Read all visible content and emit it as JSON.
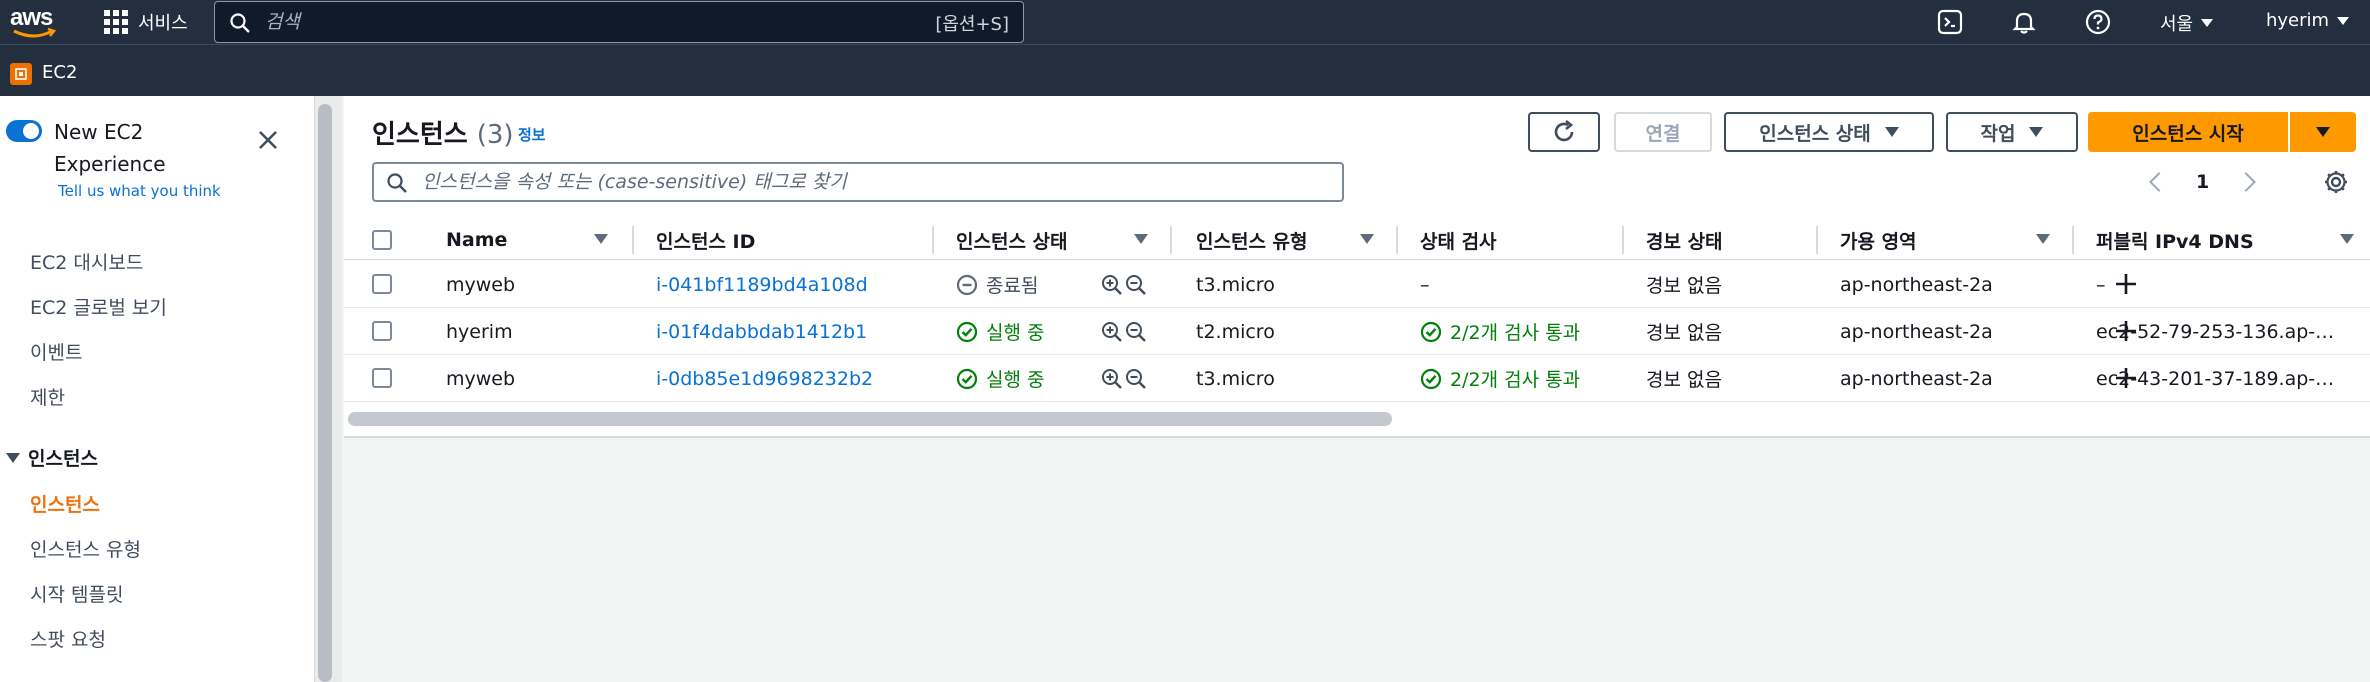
{
  "topbar": {
    "logo_text": "aws",
    "services_label": "서비스",
    "search_placeholder": "검색",
    "search_shortcut": "[옵션+S]",
    "region": "서울",
    "user": "hyerim"
  },
  "servicebar": {
    "service_name": "EC2"
  },
  "sidebar": {
    "new_experience": "New EC2 Experience",
    "feedback_link": "Tell us what you think",
    "items": [
      "EC2 대시보드",
      "EC2 글로벌 보기",
      "이벤트",
      "제한"
    ],
    "section_title": "인스턴스",
    "section_items": [
      "인스턴스",
      "인스턴스 유형",
      "시작 템플릿",
      "스팟 요청"
    ]
  },
  "panel": {
    "title": "인스턴스",
    "count": "(3)",
    "info": "정보",
    "buttons": {
      "connect": "연결",
      "instance_state": "인스턴스 상태",
      "actions": "작업",
      "launch": "인스턴스 시작"
    },
    "filter_placeholder": "인스턴스을 속성 또는 (case-sensitive) 태그로 찾기",
    "page": "1"
  },
  "table": {
    "columns": [
      "Name",
      "인스턴스 ID",
      "인스턴스 상태",
      "인스턴스 유형",
      "상태 검사",
      "경보 상태",
      "가용 영역",
      "퍼블릭 IPv4 DNS"
    ],
    "rows": [
      {
        "name": "myweb",
        "id": "i-041bf1189bd4a108d",
        "state": "종료됨",
        "state_kind": "stopped",
        "type": "t3.micro",
        "check": "–",
        "check_ok": false,
        "alarm": "경보 없음",
        "az": "ap-northeast-2a",
        "dns": "–"
      },
      {
        "name": "hyerim",
        "id": "i-01f4dabbdab1412b1",
        "state": "실행 중",
        "state_kind": "running",
        "type": "t2.micro",
        "check": "2/2개 검사 통과",
        "check_ok": true,
        "alarm": "경보 없음",
        "az": "ap-northeast-2a",
        "dns": "ec2-52-79-253-136.ap-…"
      },
      {
        "name": "myweb",
        "id": "i-0db85e1d9698232b2",
        "state": "실행 중",
        "state_kind": "running",
        "type": "t3.micro",
        "check": "2/2개 검사 통과",
        "check_ok": true,
        "alarm": "경보 없음",
        "az": "ap-northeast-2a",
        "dns": "ec2-43-201-37-189.ap-…"
      }
    ]
  },
  "colors": {
    "nav_bg": "#232f3e",
    "accent_orange": "#ff9900",
    "link_blue": "#0972d3",
    "success_green": "#037f0c"
  }
}
